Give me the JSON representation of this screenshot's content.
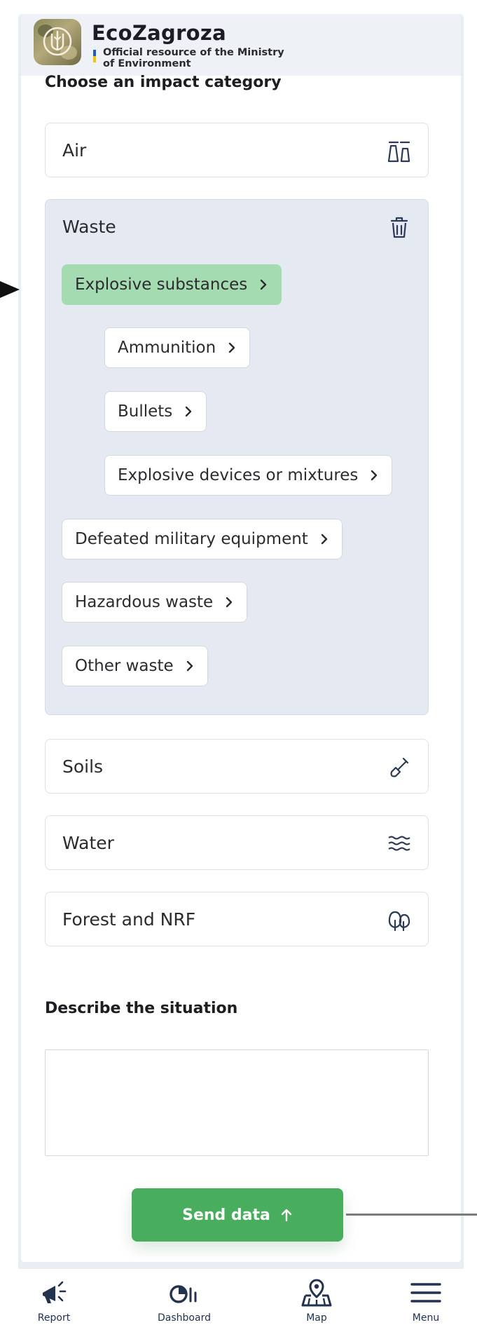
{
  "header": {
    "brand_title": "EcoZagroza",
    "brand_subtitle_line1": "Official resource of the Ministry",
    "brand_subtitle_line2": "of Environment",
    "flag_colors": [
      "#1e5bc6",
      "#f5c400"
    ]
  },
  "impact": {
    "heading": "Choose an impact category",
    "categories": [
      {
        "label": "Air",
        "icon": "air-icon"
      },
      {
        "label": "Waste",
        "icon": "trash-icon",
        "expanded": true
      },
      {
        "label": "Soils",
        "icon": "shovel-icon"
      },
      {
        "label": "Water",
        "icon": "water-waves-icon"
      },
      {
        "label": "Forest and NRF",
        "icon": "tree-icon"
      }
    ],
    "waste_subcategories": [
      {
        "label": "Explosive substances",
        "selected": true
      },
      {
        "label": "Ammunition"
      },
      {
        "label": "Bullets"
      },
      {
        "label": "Explosive devices or mixtures"
      },
      {
        "label": "Defeated military equipment"
      },
      {
        "label": "Hazardous waste"
      },
      {
        "label": "Other waste"
      }
    ]
  },
  "describe": {
    "heading": "Describe the situation",
    "value": ""
  },
  "actions": {
    "send_label": "Send data"
  },
  "bottom_nav": {
    "items": [
      {
        "label": "Report",
        "icon": "megaphone-icon"
      },
      {
        "label": "Dashboard",
        "icon": "dashboard-chart-icon"
      },
      {
        "label": "Map",
        "icon": "map-pin-icon"
      },
      {
        "label": "Menu",
        "icon": "hamburger-menu-icon"
      }
    ]
  },
  "colors": {
    "accent_green": "#48ad5c",
    "selected_chip": "#a5dbb0",
    "expanded_panel": "#e4e9f2",
    "nav_icon": "#22324f"
  }
}
